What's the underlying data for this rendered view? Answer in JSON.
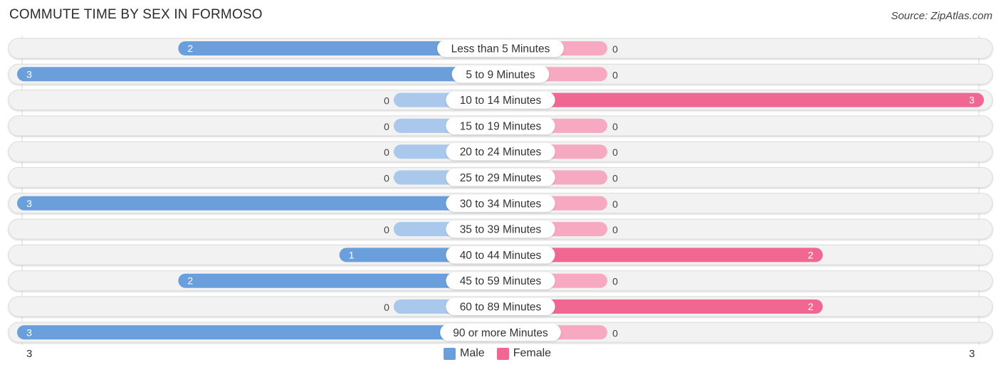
{
  "header": {
    "title": "COMMUTE TIME BY SEX IN FORMOSO",
    "source": "Source: ZipAtlas.com"
  },
  "colors": {
    "male": "#6a9fdc",
    "male_light": "#a9c8ec",
    "female": "#f06892",
    "female_light": "#f7a9c1",
    "row_bg": "#f2f2f2"
  },
  "chart_data": {
    "type": "bar",
    "orientation": "horizontal-diverging",
    "title": "COMMUTE TIME BY SEX IN FORMOSO",
    "categories": [
      "Less than 5 Minutes",
      "5 to 9 Minutes",
      "10 to 14 Minutes",
      "15 to 19 Minutes",
      "20 to 24 Minutes",
      "25 to 29 Minutes",
      "30 to 34 Minutes",
      "35 to 39 Minutes",
      "40 to 44 Minutes",
      "45 to 59 Minutes",
      "60 to 89 Minutes",
      "90 or more Minutes"
    ],
    "series": [
      {
        "name": "Male",
        "values": [
          2,
          3,
          0,
          0,
          0,
          0,
          3,
          0,
          1,
          2,
          0,
          3
        ]
      },
      {
        "name": "Female",
        "values": [
          0,
          0,
          3,
          0,
          0,
          0,
          0,
          0,
          2,
          0,
          2,
          0
        ]
      }
    ],
    "xlim": [
      -3,
      3
    ],
    "axis_labels": {
      "left": "3",
      "right": "3"
    },
    "legend": {
      "position": "bottom-center",
      "entries": [
        "Male",
        "Female"
      ]
    }
  }
}
